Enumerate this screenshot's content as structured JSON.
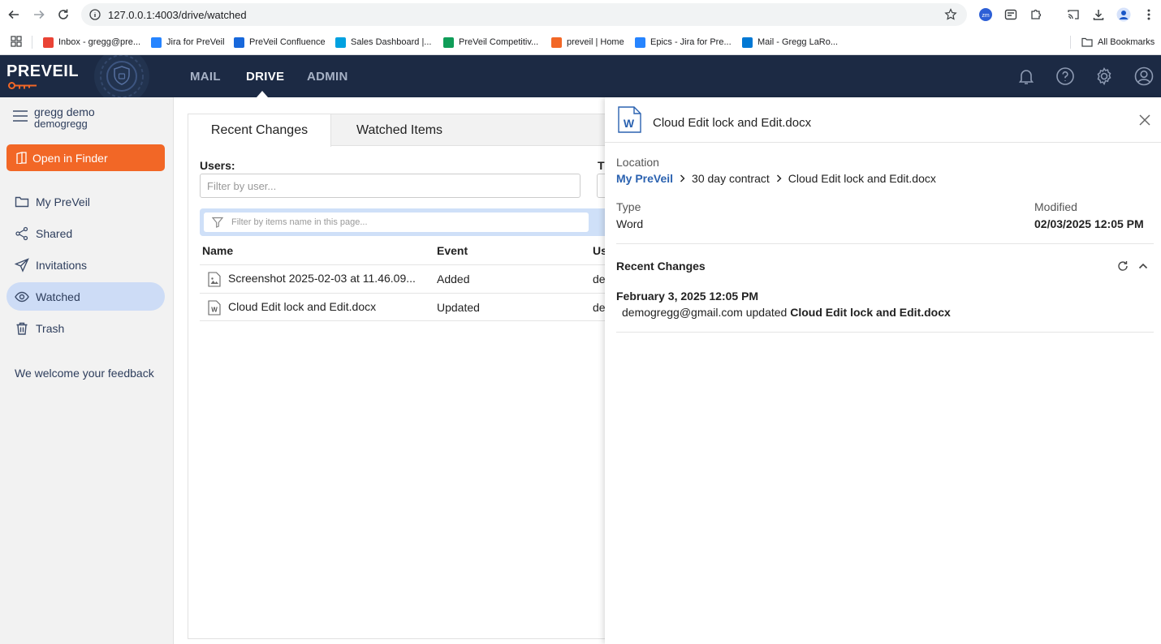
{
  "browser": {
    "url": "127.0.0.1:4003/drive/watched",
    "bookmarks": [
      {
        "label": "Inbox - gregg@pre...",
        "color": "#ea4335"
      },
      {
        "label": "Jira for PreVeil",
        "color": "#2684ff"
      },
      {
        "label": "PreVeil Confluence",
        "color": "#1868db"
      },
      {
        "label": "Sales Dashboard |...",
        "color": "#00a1e0"
      },
      {
        "label": "PreVeil Competitiv...",
        "color": "#0f9d58"
      },
      {
        "label": "preveil | Home",
        "color": "#f26726"
      },
      {
        "label": "Epics - Jira for Pre...",
        "color": "#2684ff"
      },
      {
        "label": "Mail - Gregg LaRo...",
        "color": "#0078d4"
      }
    ],
    "all_bookmarks": "All Bookmarks"
  },
  "app": {
    "logo": "PREVEIL",
    "nav": [
      "MAIL",
      "DRIVE",
      "ADMIN"
    ],
    "active_nav": "DRIVE",
    "accent_color": "#f26726",
    "header_color": "#1c2a44"
  },
  "sidebar": {
    "user_name": "gregg demo",
    "user_id": "demogregg",
    "open_finder": "Open in Finder",
    "items": [
      {
        "label": "My PreVeil",
        "icon": "folder-icon"
      },
      {
        "label": "Shared",
        "icon": "share-icon"
      },
      {
        "label": "Invitations",
        "icon": "send-icon"
      },
      {
        "label": "Watched",
        "icon": "eye-icon"
      },
      {
        "label": "Trash",
        "icon": "trash-icon"
      }
    ],
    "active_item": "Watched",
    "feedback": "We welcome your feedback"
  },
  "main": {
    "tabs": [
      "Recent Changes",
      "Watched Items"
    ],
    "active_tab": "Recent Changes",
    "users_label": "Users:",
    "users_placeholder": "Filter by user...",
    "type_label_partial": "T",
    "filter_placeholder": "Filter by items name in this page...",
    "columns": [
      "Name",
      "Event",
      "Us"
    ],
    "rows": [
      {
        "name": "Screenshot 2025-02-03 at 11.46.09...",
        "event": "Added",
        "user": "de",
        "icon": "image-file-icon"
      },
      {
        "name": "Cloud Edit lock and Edit.docx",
        "event": "Updated",
        "user": "de",
        "icon": "word-file-icon"
      }
    ]
  },
  "details": {
    "title": "Cloud Edit lock and Edit.docx",
    "location_label": "Location",
    "breadcrumb": [
      "My PreVeil",
      "30 day contract",
      "Cloud Edit lock and Edit.docx"
    ],
    "type_label": "Type",
    "type_value": "Word",
    "modified_label": "Modified",
    "modified_value": "02/03/2025 12:05 PM",
    "recent_changes_label": "Recent Changes",
    "changes": [
      {
        "date": "February 3, 2025 12:05 PM",
        "actor": "demogregg@gmail.com",
        "action": "updated",
        "target": "Cloud Edit lock and Edit.docx"
      }
    ]
  }
}
